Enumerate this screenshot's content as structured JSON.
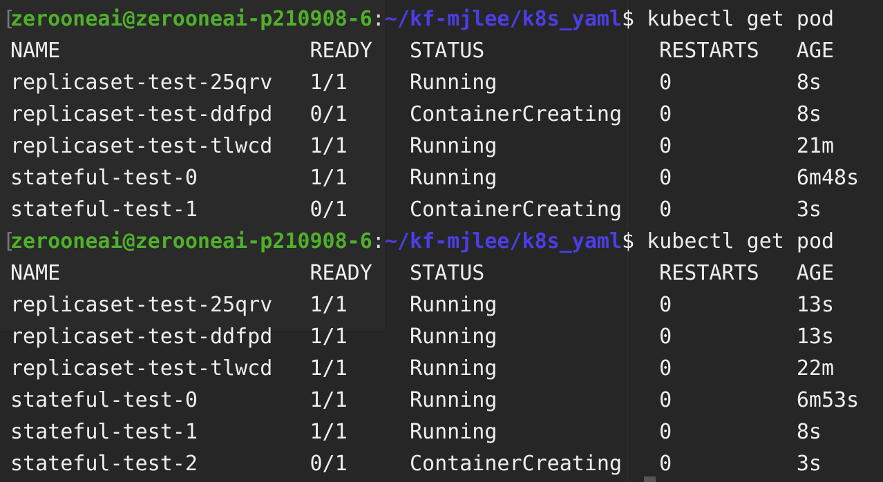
{
  "colors": {
    "background": "#262626",
    "user_host": "#4fb02a",
    "path": "#4a3ee6",
    "text": "#eeeeee"
  },
  "blocks": [
    {
      "prompt": {
        "bracket": "[",
        "user_host": "zerooneai@zerooneai-p210908-6",
        "colon": ":",
        "path": "~/kf-mjlee/k8s_yaml",
        "symbol": "$ ",
        "command": "kubectl get pod"
      },
      "headers": [
        "NAME",
        "READY",
        "STATUS",
        "RESTARTS",
        "AGE"
      ],
      "rows": [
        [
          "replicaset-test-25qrv",
          "1/1",
          "Running",
          "0",
          "8s"
        ],
        [
          "replicaset-test-ddfpd",
          "0/1",
          "ContainerCreating",
          "0",
          "8s"
        ],
        [
          "replicaset-test-tlwcd",
          "1/1",
          "Running",
          "0",
          "21m"
        ],
        [
          "stateful-test-0",
          "1/1",
          "Running",
          "0",
          "6m48s"
        ],
        [
          "stateful-test-1",
          "0/1",
          "ContainerCreating",
          "0",
          "3s"
        ]
      ]
    },
    {
      "prompt": {
        "bracket": "[",
        "user_host": "zerooneai@zerooneai-p210908-6",
        "colon": ":",
        "path": "~/kf-mjlee/k8s_yaml",
        "symbol": "$ ",
        "command": "kubectl get pod"
      },
      "headers": [
        "NAME",
        "READY",
        "STATUS",
        "RESTARTS",
        "AGE"
      ],
      "rows": [
        [
          "replicaset-test-25qrv",
          "1/1",
          "Running",
          "0",
          "13s"
        ],
        [
          "replicaset-test-ddfpd",
          "1/1",
          "Running",
          "0",
          "13s"
        ],
        [
          "replicaset-test-tlwcd",
          "1/1",
          "Running",
          "0",
          "22m"
        ],
        [
          "stateful-test-0",
          "1/1",
          "Running",
          "0",
          "6m53s"
        ],
        [
          "stateful-test-1",
          "1/1",
          "Running",
          "0",
          "8s"
        ],
        [
          "stateful-test-2",
          "0/1",
          "ContainerCreating",
          "0",
          "3s"
        ]
      ]
    }
  ]
}
